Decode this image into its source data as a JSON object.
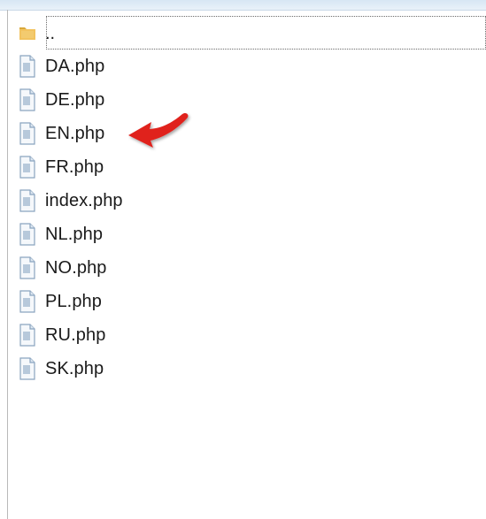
{
  "window": {
    "pane_title": ""
  },
  "parent_entry": {
    "label": "..",
    "icon": "folder-icon"
  },
  "files": [
    {
      "label": "DA.php",
      "icon": "php-file-icon"
    },
    {
      "label": "DE.php",
      "icon": "php-file-icon"
    },
    {
      "label": "EN.php",
      "icon": "php-file-icon"
    },
    {
      "label": "FR.php",
      "icon": "php-file-icon"
    },
    {
      "label": "index.php",
      "icon": "php-file-icon"
    },
    {
      "label": "NL.php",
      "icon": "php-file-icon"
    },
    {
      "label": "NO.php",
      "icon": "php-file-icon"
    },
    {
      "label": "PL.php",
      "icon": "php-file-icon"
    },
    {
      "label": "RU.php",
      "icon": "php-file-icon"
    },
    {
      "label": "SK.php",
      "icon": "php-file-icon"
    }
  ],
  "annotation": {
    "type": "red-arrow-icon",
    "points_to": "EN.php",
    "color": "#e0231f"
  },
  "colors": {
    "folder": "#e7b84a",
    "file_icon": "#8aa4bf",
    "text": "#1a1a1a",
    "header_strip": "#d7e6f4"
  }
}
